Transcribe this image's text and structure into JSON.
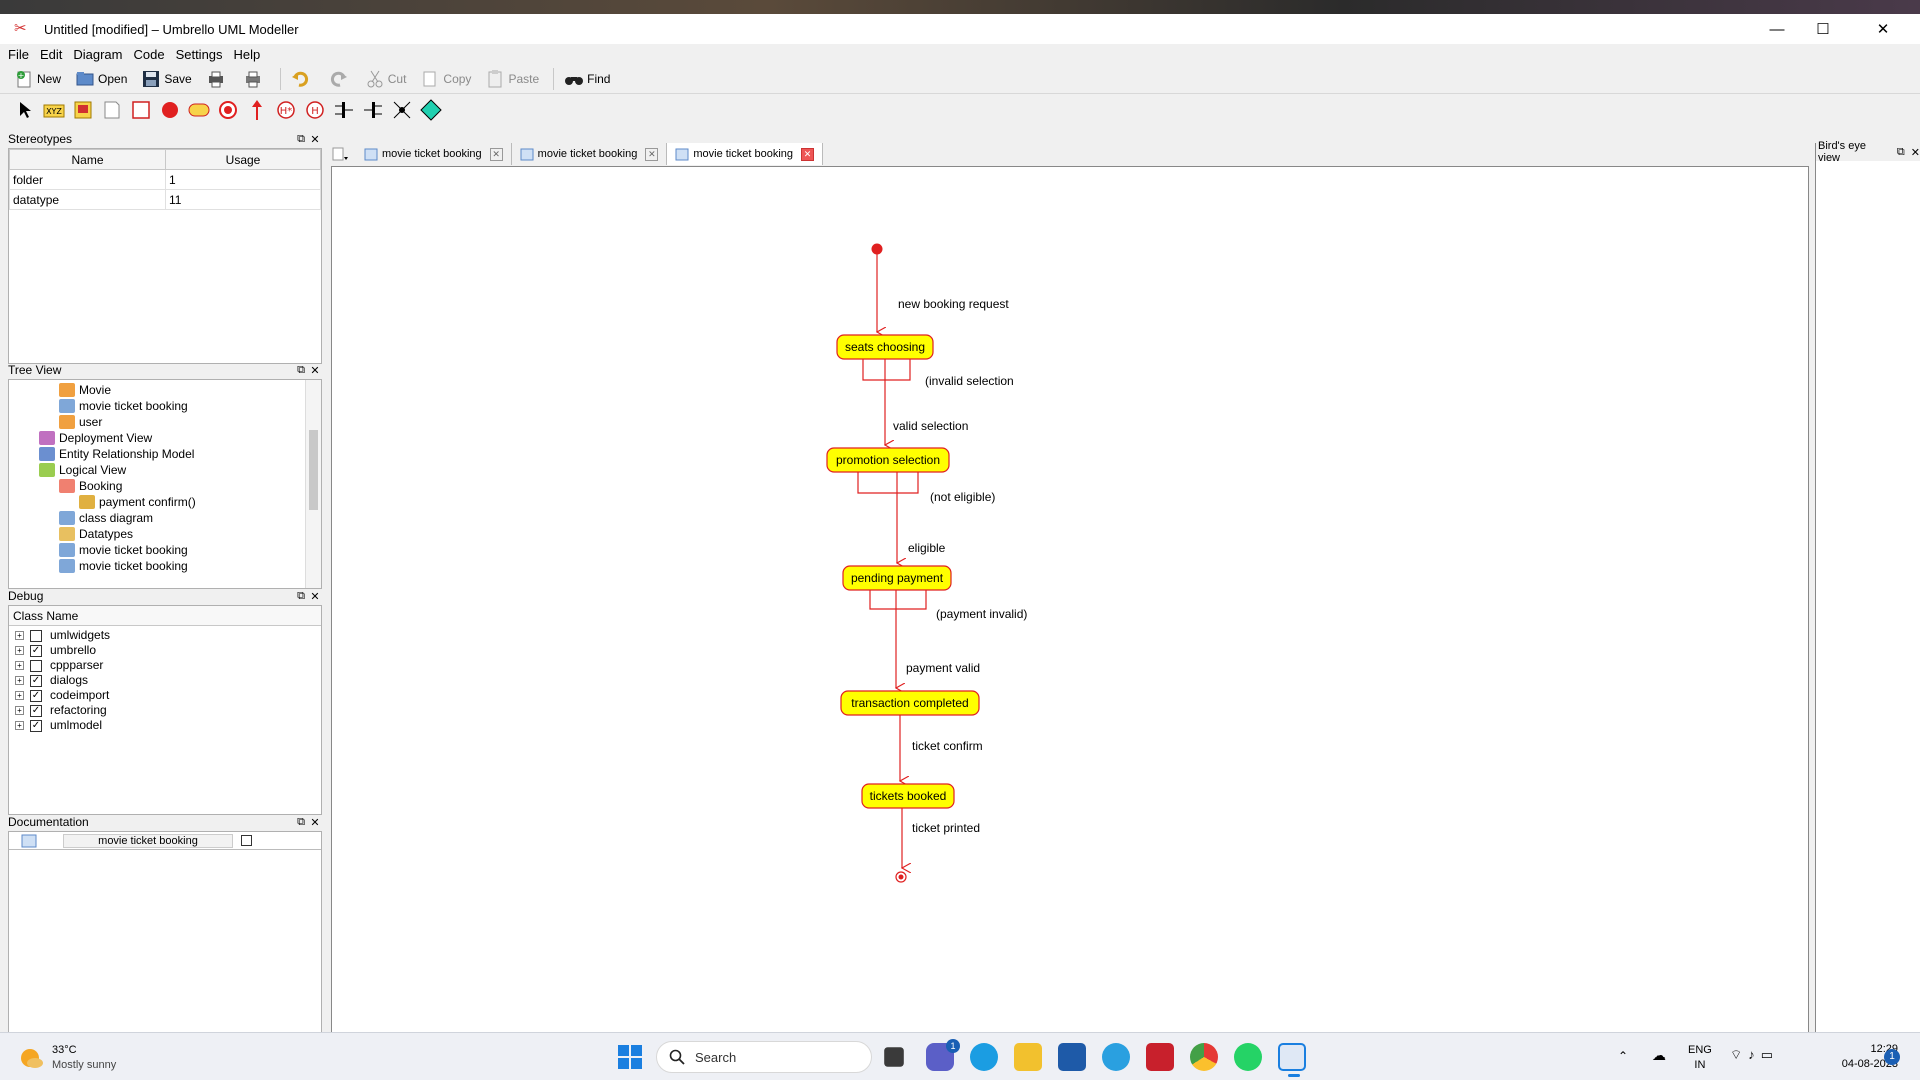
{
  "window": {
    "title": "Untitled [modified] – Umbrello UML Modeller"
  },
  "menu": [
    "File",
    "Edit",
    "Diagram",
    "Code",
    "Settings",
    "Help"
  ],
  "toolbar": {
    "new": "New",
    "open": "Open",
    "save": "Save",
    "cut": "Cut",
    "copy": "Copy",
    "paste": "Paste",
    "find": "Find"
  },
  "stereotypes": {
    "title": "Stereotypes",
    "col_name": "Name",
    "col_usage": "Usage",
    "rows": [
      {
        "name": "folder",
        "usage": "1"
      },
      {
        "name": "datatype",
        "usage": "11"
      }
    ]
  },
  "treeview": {
    "title": "Tree View",
    "items": [
      {
        "label": "Movie",
        "indent": 3,
        "color": "#f0a040"
      },
      {
        "label": "movie ticket booking",
        "indent": 3,
        "color": "#7fa7d8"
      },
      {
        "label": "user",
        "indent": 3,
        "color": "#f0a040"
      },
      {
        "label": "Deployment View",
        "indent": 2,
        "color": "#c070c0"
      },
      {
        "label": "Entity Relationship Model",
        "indent": 2,
        "color": "#6b8fd0"
      },
      {
        "label": "Logical View",
        "indent": 2,
        "color": "#9acd50"
      },
      {
        "label": "Booking",
        "indent": 3,
        "color": "#f08070"
      },
      {
        "label": "payment confirm()",
        "indent": 4,
        "color": "#e0b040"
      },
      {
        "label": "class diagram",
        "indent": 3,
        "color": "#7fa7d8"
      },
      {
        "label": "Datatypes",
        "indent": 3,
        "color": "#e8c060"
      },
      {
        "label": "movie ticket booking",
        "indent": 3,
        "color": "#7fa7d8"
      },
      {
        "label": "movie ticket booking",
        "indent": 3,
        "color": "#7fa7d8"
      }
    ]
  },
  "debug": {
    "title": "Debug",
    "col": "Class Name",
    "items": [
      {
        "label": "umlwidgets",
        "checked": false
      },
      {
        "label": "umbrello",
        "checked": true
      },
      {
        "label": "cppparser",
        "checked": false
      },
      {
        "label": "dialogs",
        "checked": true
      },
      {
        "label": "codeimport",
        "checked": true
      },
      {
        "label": "refactoring",
        "checked": true
      },
      {
        "label": "umlmodel",
        "checked": true
      }
    ]
  },
  "documentation": {
    "title": "Documentation",
    "diagram": "movie ticket booking"
  },
  "tabs": [
    "movie ticket booking",
    "movie ticket booking",
    "movie ticket booking"
  ],
  "birds_eye": {
    "title": "Bird's eye view"
  },
  "diagram": {
    "states": [
      {
        "id": "s1",
        "label": "seats choosing"
      },
      {
        "id": "s2",
        "label": "promotion selection"
      },
      {
        "id": "s3",
        "label": "pending payment"
      },
      {
        "id": "s4",
        "label": "transaction completed"
      },
      {
        "id": "s5",
        "label": "tickets booked"
      }
    ],
    "transitions": {
      "t0": "new booking request",
      "t1self": "(invalid selection",
      "t1": "valid selection",
      "t2self": "(not eligible)",
      "t2": "eligible",
      "t3self": "(payment invalid)",
      "t3": "payment valid",
      "t4": "ticket confirm",
      "t5": "ticket printed"
    }
  },
  "taskbar": {
    "temp": "33°C",
    "weather": "Mostly sunny",
    "search": "Search",
    "lang1": "ENG",
    "lang2": "IN",
    "time": "12:29",
    "date": "04-08-2023",
    "teams_badge": "1",
    "notif": "1"
  }
}
